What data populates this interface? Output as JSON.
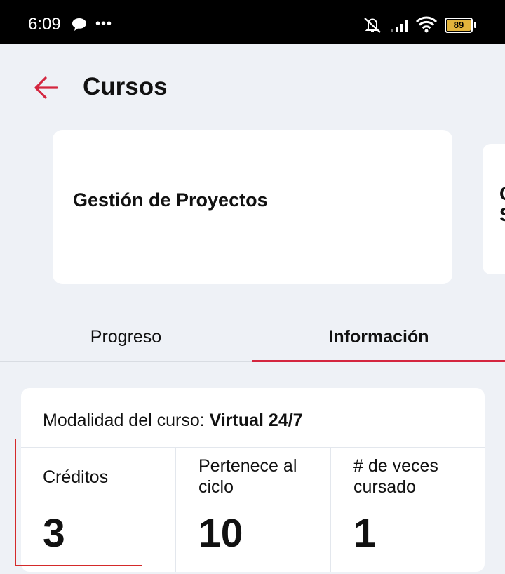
{
  "status_bar": {
    "time": "6:09",
    "icons": [
      "chat-icon",
      "more-dots-icon",
      "mute-icon",
      "signal-icon",
      "wifi-icon",
      "battery-icon"
    ],
    "battery_level": "89",
    "battery_color": "#e3b43c"
  },
  "header": {
    "back_icon": "arrow-left-icon",
    "title": "Cursos",
    "accent_color": "#d4263f"
  },
  "course_carousel": {
    "current_course": "Gestión de Proyectos",
    "next_course_partial": "C\nS"
  },
  "tabs": [
    {
      "label": "Progreso",
      "selected": false
    },
    {
      "label": "Información",
      "selected": true
    }
  ],
  "info": {
    "modalidad_label": "Modalidad del curso: ",
    "modalidad_value": "Virtual 24/7",
    "stats": [
      {
        "label": "Créditos",
        "value": "3"
      },
      {
        "label": "Pertenece al ciclo",
        "value": "10"
      },
      {
        "label": "# de veces cursado",
        "value": "1"
      }
    ]
  }
}
